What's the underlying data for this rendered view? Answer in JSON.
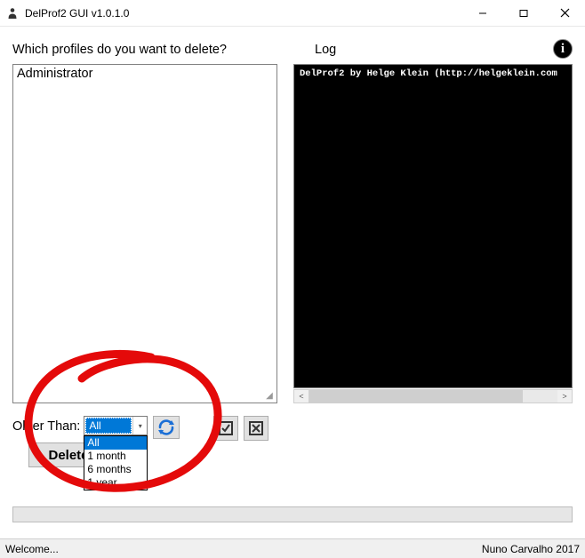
{
  "window": {
    "title": "DelProf2 GUI v1.0.1.0"
  },
  "labels": {
    "question": "Which profiles do you want to delete?",
    "log": "Log"
  },
  "profiles": {
    "items": [
      "Administrator"
    ]
  },
  "log": {
    "line1": "DelProf2 by Helge Klein (http://helgeklein.com"
  },
  "older_than": {
    "label": "Older Than:",
    "selected": "All",
    "options": [
      "All",
      "1 month",
      "6 months",
      "1 year"
    ]
  },
  "buttons": {
    "delete": "Delete"
  },
  "status": {
    "left": "Welcome...",
    "right": "Nuno Carvalho 2017"
  },
  "info_glyph": "i"
}
